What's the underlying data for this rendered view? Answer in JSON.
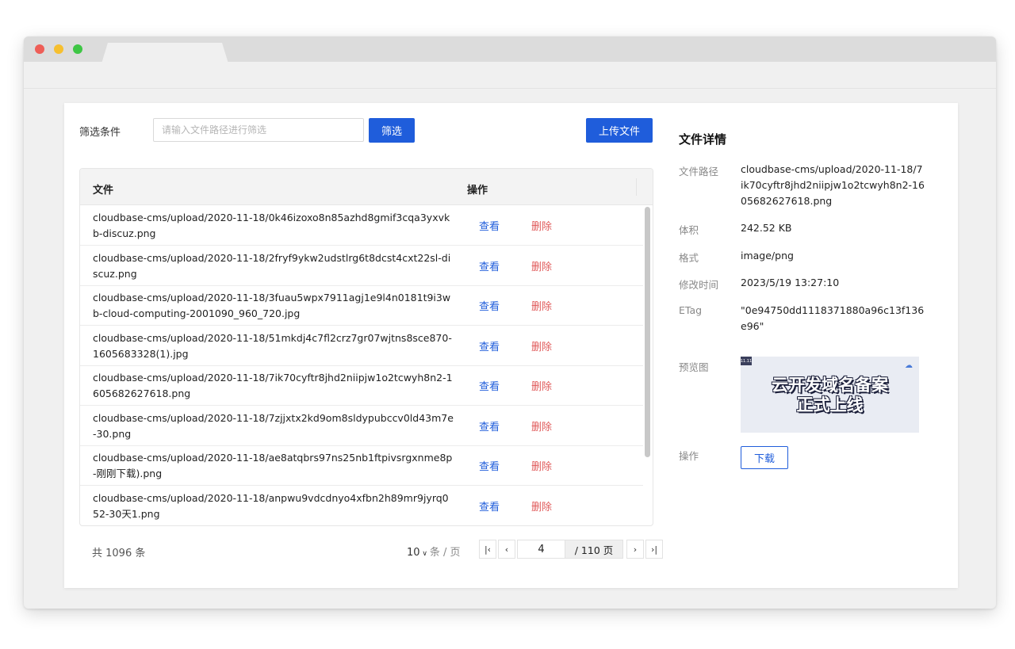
{
  "filter": {
    "label": "筛选条件",
    "placeholder": "请输入文件路径进行筛选",
    "value": "",
    "button": "筛选"
  },
  "upload_button": "上传文件",
  "table": {
    "headers": {
      "file": "文件",
      "operation": "操作"
    },
    "view_label": "查看",
    "delete_label": "删除",
    "rows": [
      {
        "file": "cloudbase-cms/upload/2020-11-18/0k46izoxo8n85azhd8gmif3cqa3yxvkb-discuz.png"
      },
      {
        "file": "cloudbase-cms/upload/2020-11-18/2fryf9ykw2udstlrg6t8dcst4cxt22sl-discuz.png"
      },
      {
        "file": "cloudbase-cms/upload/2020-11-18/3fuau5wpx7911agj1e9l4n0181t9i3wb-cloud-computing-2001090_960_720.jpg"
      },
      {
        "file": "cloudbase-cms/upload/2020-11-18/51mkdj4c7fl2crz7gr07wjtns8sce870-1605683328(1).jpg"
      },
      {
        "file": "cloudbase-cms/upload/2020-11-18/7ik70cyftr8jhd2niipjw1o2tcwyh8n2-1605682627618.png"
      },
      {
        "file": "cloudbase-cms/upload/2020-11-18/7zjjxtx2kd9om8sldypubccv0ld43m7e-30.png"
      },
      {
        "file": "cloudbase-cms/upload/2020-11-18/ae8atqbrs97ns25nb1ftpivsrgxnme8p-刚刚下载).png"
      },
      {
        "file": "cloudbase-cms/upload/2020-11-18/anpwu9vdcdnyo4xfbn2h89mr9jyrq052-30天1.png"
      }
    ]
  },
  "pagination": {
    "total": "共 1096 条",
    "page_size": "10",
    "page_size_unit": "条 / 页",
    "current_page": "4",
    "total_pages": "/ 110 页"
  },
  "details": {
    "title": "文件详情",
    "path_label": "文件路径",
    "path": "cloudbase-cms/upload/2020-11-18/7ik70cyftr8jhd2niipjw1o2tcwyh8n2-1605682627618.png",
    "size_label": "体积",
    "size": "242.52 KB",
    "format_label": "格式",
    "format": "image/png",
    "modified_label": "修改时间",
    "modified": "2023/5/19 13:27:10",
    "etag_label": "ETag",
    "etag": "\"0e94750dd1118371880a96c13f136e96\"",
    "preview_label": "预览图",
    "preview_text_line1": "云开发域名备案",
    "preview_text_line2": "正式上线",
    "actions_label": "操作",
    "download_button": "下载"
  }
}
